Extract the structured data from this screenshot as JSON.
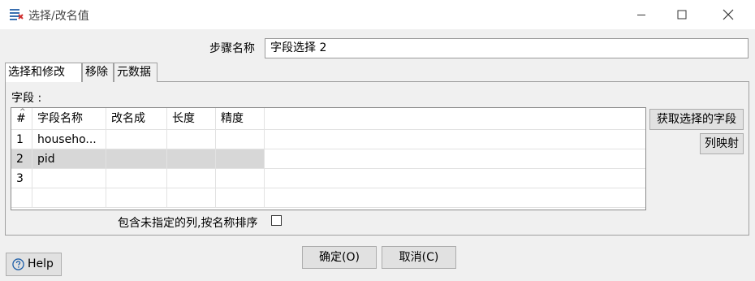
{
  "window": {
    "title": "选择/改名值"
  },
  "step": {
    "label": "步骤名称",
    "value": "字段选择 2"
  },
  "tabs": [
    {
      "label": "选择和修改",
      "active": true
    },
    {
      "label": "移除",
      "active": false
    },
    {
      "label": "元数据",
      "active": false
    }
  ],
  "fields": {
    "label": "字段 :",
    "columns": [
      "#",
      "字段名称",
      "改名成",
      "长度",
      "精度"
    ],
    "rows": [
      {
        "num": "1",
        "name": "househo...",
        "rename": "",
        "length": "",
        "precision": "",
        "selected": false
      },
      {
        "num": "2",
        "name": "pid",
        "rename": "",
        "length": "",
        "precision": "",
        "selected": true
      },
      {
        "num": "3",
        "name": "",
        "rename": "",
        "length": "",
        "precision": "",
        "selected": false
      }
    ]
  },
  "buttons": {
    "get_fields": "获取选择的字段",
    "column_mapping": "列映射",
    "ok": "确定(O)",
    "cancel": "取消(C)",
    "help": "Help"
  },
  "include_unspecified": {
    "label": "包含未指定的列,按名称排序",
    "checked": false
  },
  "colors": {
    "selected_row": "#d7d7d7",
    "button_bg": "#e1e1e1",
    "help_icon": "#1f5fa8"
  }
}
